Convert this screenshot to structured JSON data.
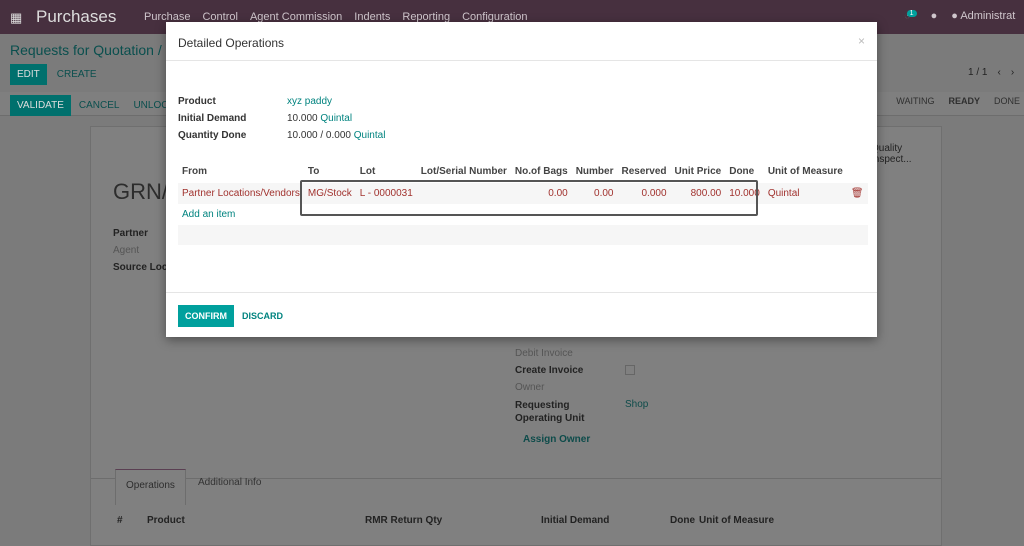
{
  "nav": {
    "app": "Purchases",
    "menu": [
      "Purchase",
      "Control",
      "Agent Commission",
      "Indents",
      "Reporting",
      "Configuration"
    ],
    "activity_count": "1",
    "user": "Administrat"
  },
  "crumb": "Requests for Quotation /",
  "actions": {
    "edit": "EDIT",
    "create": "CREATE",
    "pager": "1 / 1"
  },
  "statusbar": {
    "buttons": [
      "VALIDATE",
      "CANCEL",
      "UNLOCK"
    ],
    "states": [
      "WAITING",
      "READY",
      "DONE"
    ]
  },
  "sheet": {
    "title": "GRN/",
    "quality": "Quality Inspect...",
    "partner": "Partner",
    "agent": "Agent",
    "source_location": "Source Locat",
    "debit_invoice": "Debit Invoice",
    "create_invoice": "Create Invoice",
    "owner": "Owner",
    "requesting_unit": "Requesting Operating Unit",
    "requesting_unit_value": "Shop",
    "assign_owner": "Assign Owner",
    "tabs": [
      "Operations",
      "Additional Info"
    ],
    "columns": [
      "#",
      "Product",
      "RMR Return Qty",
      "Initial Demand",
      "Done",
      "Unit of Measure"
    ]
  },
  "modal": {
    "title": "Detailed Operations",
    "close": "×",
    "product_label": "Product",
    "product": "xyz paddy",
    "initial_demand_label": "Initial Demand",
    "initial_demand": "10.000",
    "initial_demand_uom": "Quintal",
    "qty_done_label": "Quantity Done",
    "qty_done": "10.000 / 0.000",
    "qty_done_uom": "Quintal",
    "columns": [
      "From",
      "To",
      "Lot",
      "Lot/Serial Number",
      "No.of Bags",
      "Number",
      "Reserved",
      "Unit Price",
      "Done",
      "Unit of Measure"
    ],
    "rows": [
      {
        "from": "Partner Locations/Vendors",
        "to": "MG/Stock",
        "lot": "L - 0000031",
        "serial": "",
        "bags": "0.00",
        "number": "0.00",
        "reserved": "0.000",
        "price": "800.00",
        "done": "10.000",
        "uom": "Quintal"
      }
    ],
    "add_item": "Add an item",
    "confirm": "CONFIRM",
    "discard": "DISCARD"
  }
}
